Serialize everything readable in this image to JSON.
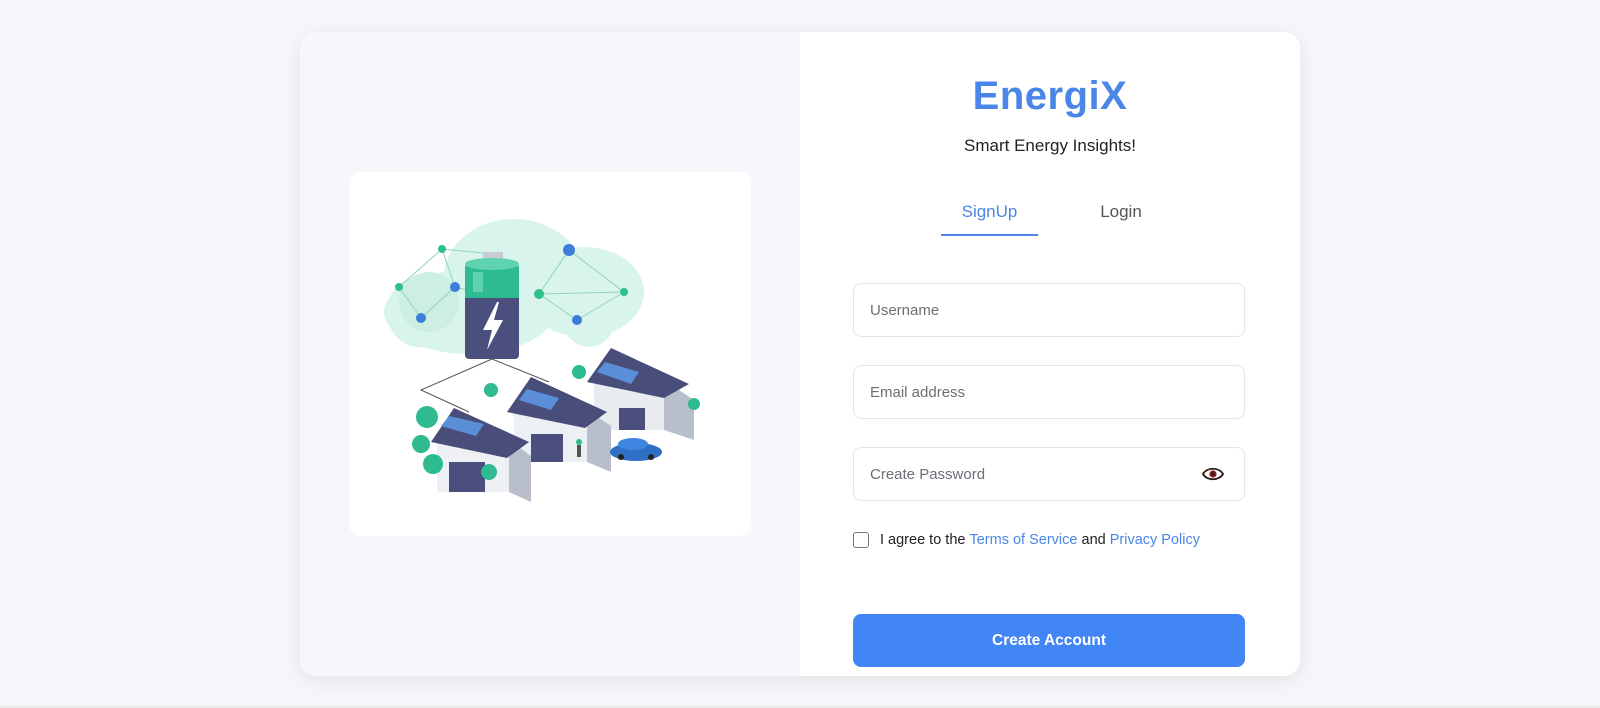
{
  "brand": {
    "name": "EnergiX",
    "tagline": "Smart Energy Insights!",
    "accent_color": "#4a86e8",
    "button_color": "#4285f4"
  },
  "illustration": {
    "icon": "energy-storage-houses-illustration"
  },
  "tabs": [
    {
      "label": "SignUp",
      "active": true
    },
    {
      "label": "Login",
      "active": false
    }
  ],
  "form": {
    "username_placeholder": "Username",
    "email_placeholder": "Email address",
    "password_placeholder": "Create Password",
    "password_toggle_icon": "eye-icon",
    "agree_prefix": "I agree to the",
    "terms_link": "Terms of Service",
    "agree_joiner": "and",
    "privacy_link": "Privacy Policy",
    "agree_checked": false,
    "submit_label": "Create Account"
  }
}
